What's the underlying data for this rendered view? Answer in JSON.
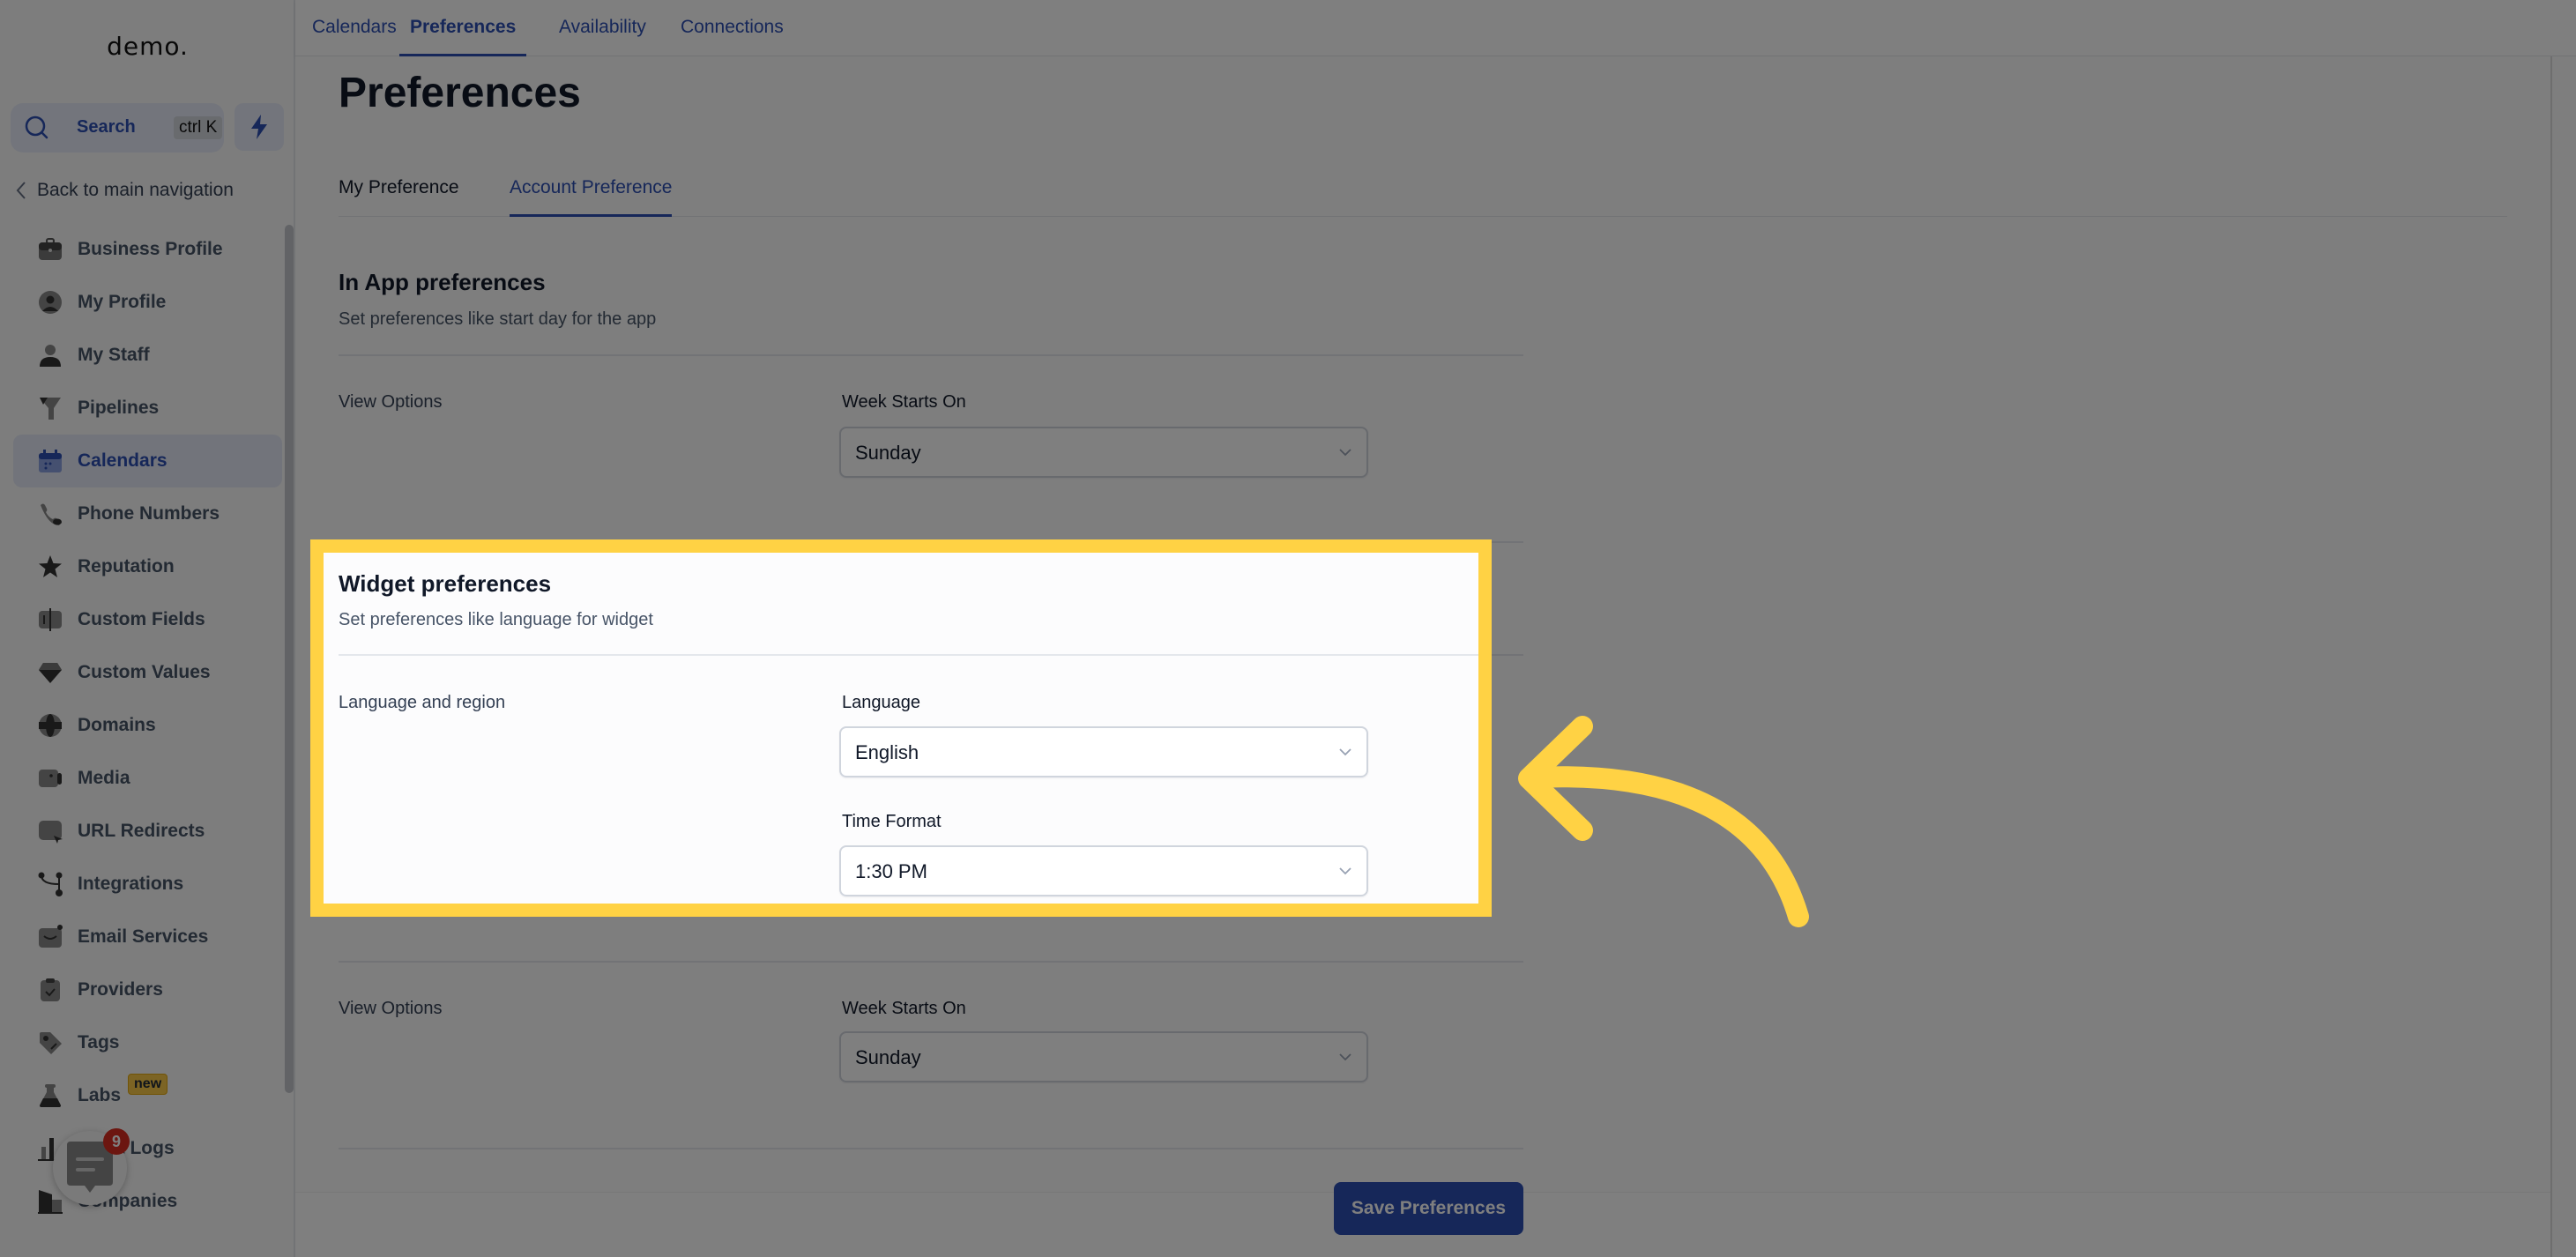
{
  "sidebar": {
    "logo": "demo.",
    "search": {
      "label": "Search",
      "shortcut": "ctrl K"
    },
    "back_label": "Back to main navigation",
    "items": [
      {
        "label": "Business Profile",
        "icon": "briefcase-icon",
        "active": false
      },
      {
        "label": "My Profile",
        "icon": "user-circle-icon",
        "active": false
      },
      {
        "label": "My Staff",
        "icon": "user-icon",
        "active": false
      },
      {
        "label": "Pipelines",
        "icon": "funnel-icon",
        "active": false
      },
      {
        "label": "Calendars",
        "icon": "calendar-icon",
        "active": true
      },
      {
        "label": "Phone Numbers",
        "icon": "phone-icon",
        "active": false
      },
      {
        "label": "Reputation",
        "icon": "star-icon",
        "active": false
      },
      {
        "label": "Custom Fields",
        "icon": "text-field-icon",
        "active": false
      },
      {
        "label": "Custom Values",
        "icon": "gem-icon",
        "active": false
      },
      {
        "label": "Domains",
        "icon": "globe-icon",
        "active": false
      },
      {
        "label": "Media",
        "icon": "video-camera-icon",
        "active": false
      },
      {
        "label": "URL Redirects",
        "icon": "cursor-box-icon",
        "active": false
      },
      {
        "label": "Integrations",
        "icon": "git-branch-icon",
        "active": false
      },
      {
        "label": "Email Services",
        "icon": "mail-icon",
        "active": false
      },
      {
        "label": "Providers",
        "icon": "clipboard-check-icon",
        "active": false
      },
      {
        "label": "Tags",
        "icon": "tag-icon",
        "active": false
      },
      {
        "label": "Labs",
        "icon": "flask-icon",
        "active": false,
        "badge": "new"
      },
      {
        "label": "Audit Logs",
        "icon": "bar-chart-icon",
        "active": false
      },
      {
        "label": "Companies",
        "icon": "building-icon",
        "active": false
      }
    ],
    "chat_widget": {
      "unread_count": "9"
    }
  },
  "top_tabs": [
    {
      "label": "Calendars",
      "active": false
    },
    {
      "label": "Preferences",
      "active": true
    },
    {
      "label": "Availability",
      "active": false
    },
    {
      "label": "Connections",
      "active": false
    }
  ],
  "page": {
    "title": "Preferences",
    "tabs": [
      {
        "label": "My Preference",
        "active": false
      },
      {
        "label": "Account Preference",
        "active": true
      }
    ],
    "in_app": {
      "title": "In App preferences",
      "subtitle": "Set preferences like start day for the app",
      "row_label": "View Options",
      "field_label": "Week Starts On",
      "value": "Sunday"
    },
    "widget": {
      "title": "Widget preferences",
      "subtitle": "Set preferences like language for widget",
      "row_label": "Language and region",
      "language_label": "Language",
      "language_value": "English",
      "time_format_label": "Time Format",
      "time_format_value": "1:30 PM"
    },
    "view_options_2": {
      "row_label": "View Options",
      "field_label": "Week Starts On",
      "value": "Sunday"
    },
    "save_label": "Save Preferences"
  },
  "colors": {
    "accent": "#2c4eb2",
    "highlight": "#ffd244",
    "overlay": "rgba(0,0,0,0.5)",
    "badge_new": "#f9c848",
    "notification": "#d92d20"
  }
}
